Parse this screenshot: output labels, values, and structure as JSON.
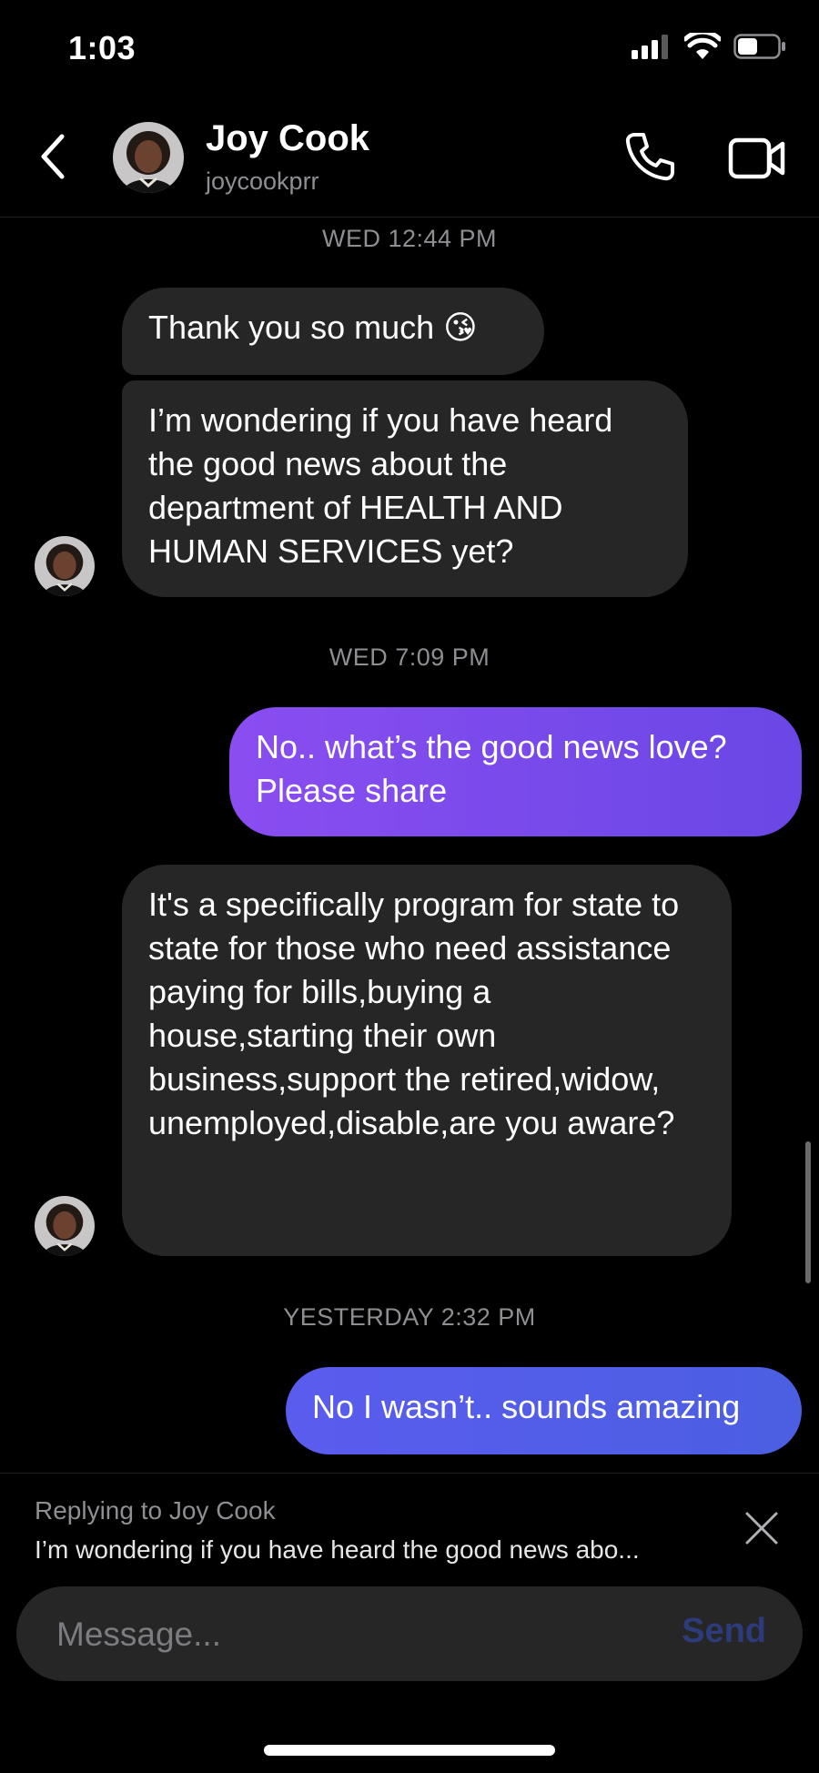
{
  "status_bar": {
    "time": "1:03"
  },
  "header": {
    "name": "Joy Cook",
    "handle": "joycookprr"
  },
  "thread": {
    "ts1": "WED 12:44 PM",
    "msg1": "Thank you so much 😘",
    "msg2": "I’m wondering if you have heard the good news about the department of HEALTH AND HUMAN SERVICES yet?",
    "ts2": "WED 7:09 PM",
    "msg3": "No.. what’s the good news love? Please share",
    "msg4": "It's a specifically program for state to state for those who need assistance paying for bills,buying a house,starting their own business,support the retired,widow, unemployed,disable,are you aware?",
    "ts3": "YESTERDAY 2:32 PM",
    "msg5": "No I wasn’t.. sounds amazing"
  },
  "reply": {
    "label": "Replying to Joy Cook",
    "snippet": "I’m wondering if you have heard the good news abo..."
  },
  "composer": {
    "placeholder": "Message...",
    "send": "Send"
  },
  "colors": {
    "incoming_bubble": "#262626",
    "outgoing_bubble": "#7a4ae8",
    "outgoing_bubble_2": "#4f5fe6"
  }
}
